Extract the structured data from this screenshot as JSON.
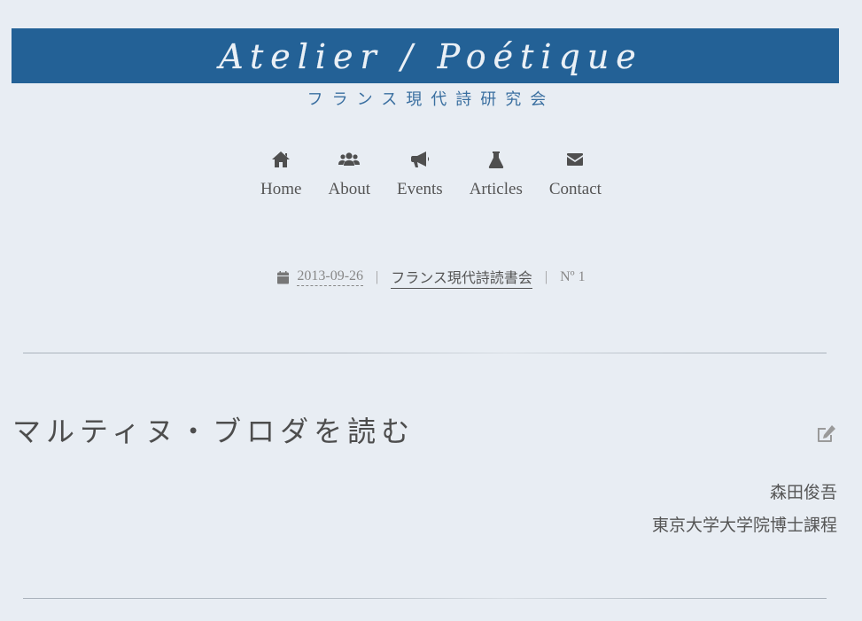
{
  "site": {
    "title": "Atelier / Poétique",
    "subtitle": "フランス現代詩研究会",
    "banner_color": "#236196"
  },
  "nav": {
    "items": [
      {
        "label": "Home",
        "icon": "home-icon"
      },
      {
        "label": "About",
        "icon": "users-icon"
      },
      {
        "label": "Events",
        "icon": "bullhorn-icon"
      },
      {
        "label": "Articles",
        "icon": "flask-icon"
      },
      {
        "label": "Contact",
        "icon": "envelope-icon"
      }
    ]
  },
  "meta": {
    "icon": "calendar-icon",
    "date": "2013-09-26",
    "separator": "|",
    "category": "フランス現代詩読書会",
    "number": "Nº 1"
  },
  "article": {
    "title": "マルティヌ・ブロダを読む",
    "edit_icon": "edit-icon",
    "author_name": "森田俊吾",
    "author_affiliation": "東京大学大学院博士課程"
  }
}
